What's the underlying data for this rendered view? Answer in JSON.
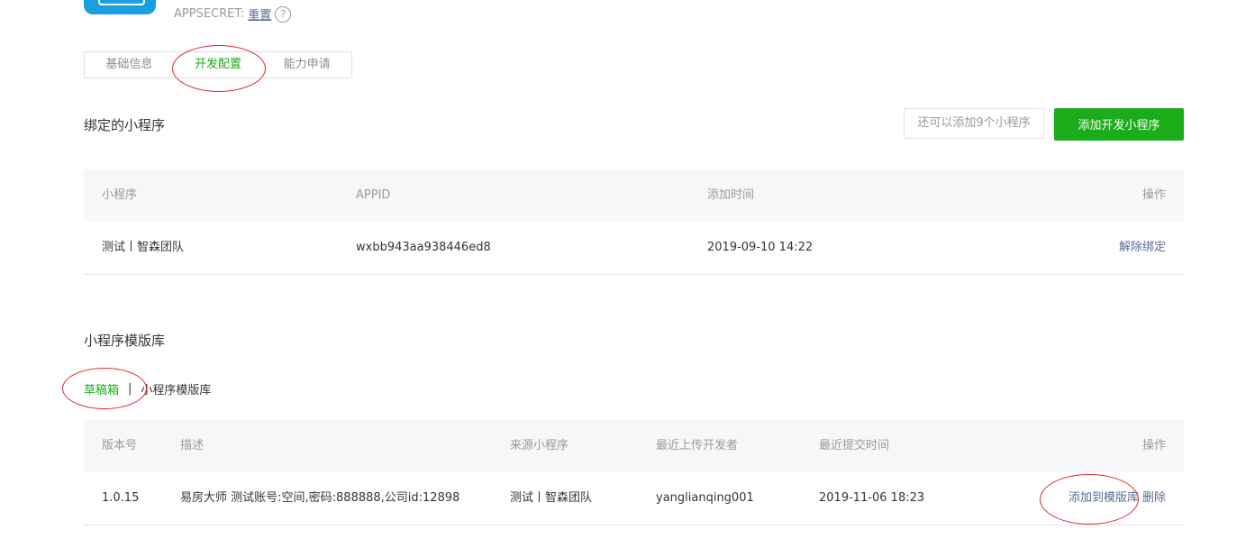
{
  "header": {
    "appsecret_label": "APPSECRET:",
    "reset_link": "重置",
    "help_glyph": "?"
  },
  "tabs": [
    {
      "label": "基础信息",
      "active": false
    },
    {
      "label": "开发配置",
      "active": true
    },
    {
      "label": "能力申请",
      "active": false
    }
  ],
  "bound": {
    "title": "绑定的小程序",
    "hint": "还可以添加9个小程序",
    "add_button": "添加开发小程序",
    "columns": [
      "小程序",
      "APPID",
      "添加时间",
      "操作"
    ],
    "rows": [
      {
        "name": "测试丨智森团队",
        "appid": "wxbb943aa938446ed8",
        "time": "2019-09-10 14:22",
        "action": "解除绑定"
      }
    ]
  },
  "templates": {
    "title": "小程序模版库",
    "subtabs": [
      {
        "label": "草稿箱",
        "active": true
      },
      {
        "label": "小程序模版库",
        "active": false
      }
    ],
    "separator": "|",
    "columns": [
      "版本号",
      "描述",
      "来源小程序",
      "最近上传开发者",
      "最近提交时间",
      "操作"
    ],
    "rows": [
      {
        "version": "1.0.15",
        "desc": "易房大师 测试账号:空间,密码:888888,公司id:12898",
        "source": "测试丨智森团队",
        "developer": "yanglianqing001",
        "time": "2019-11-06 18:23",
        "action_add": "添加到模版库",
        "action_delete": "删除"
      }
    ]
  },
  "colors": {
    "accent_green": "#1aad19",
    "link_blue": "#576b95",
    "annotation_red": "#e0262e"
  }
}
